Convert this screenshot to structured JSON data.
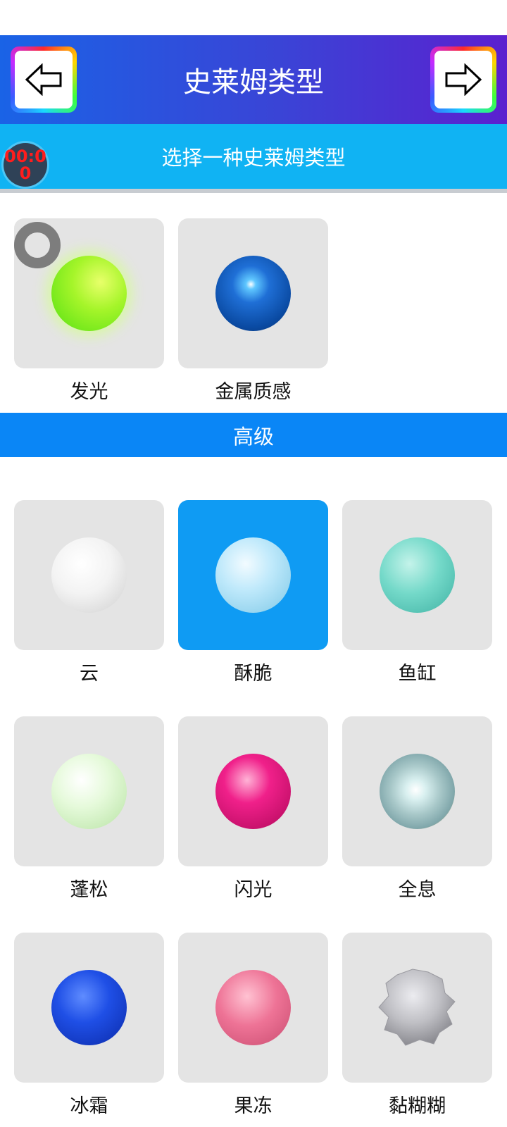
{
  "header": {
    "title": "史莱姆类型",
    "back_icon": "arrow-left-icon",
    "forward_icon": "arrow-right-icon"
  },
  "subheader": {
    "text": "选择一种史莱姆类型",
    "timer": "00:00"
  },
  "basic_items": [
    {
      "label": "发光",
      "color": "#7cf01a"
    },
    {
      "label": "金属质感",
      "color": "#0d59b8"
    }
  ],
  "section": {
    "title": "高级"
  },
  "advanced_items": [
    {
      "label": "云",
      "color": "#f4f4f4"
    },
    {
      "label": "酥脆",
      "color": "#b8e6fa",
      "selected": true
    },
    {
      "label": "鱼缸",
      "color": "#6fd8c8"
    },
    {
      "label": "蓬松",
      "color": "#dff7cf"
    },
    {
      "label": "闪光",
      "color": "#e8147a"
    },
    {
      "label": "全息",
      "color": "#a9cfd0"
    },
    {
      "label": "冰霜",
      "color": "#1a46e0"
    },
    {
      "label": "果冻",
      "color": "#ec6d8f"
    },
    {
      "label": "黏糊糊",
      "color": "#c8c8cc"
    }
  ]
}
